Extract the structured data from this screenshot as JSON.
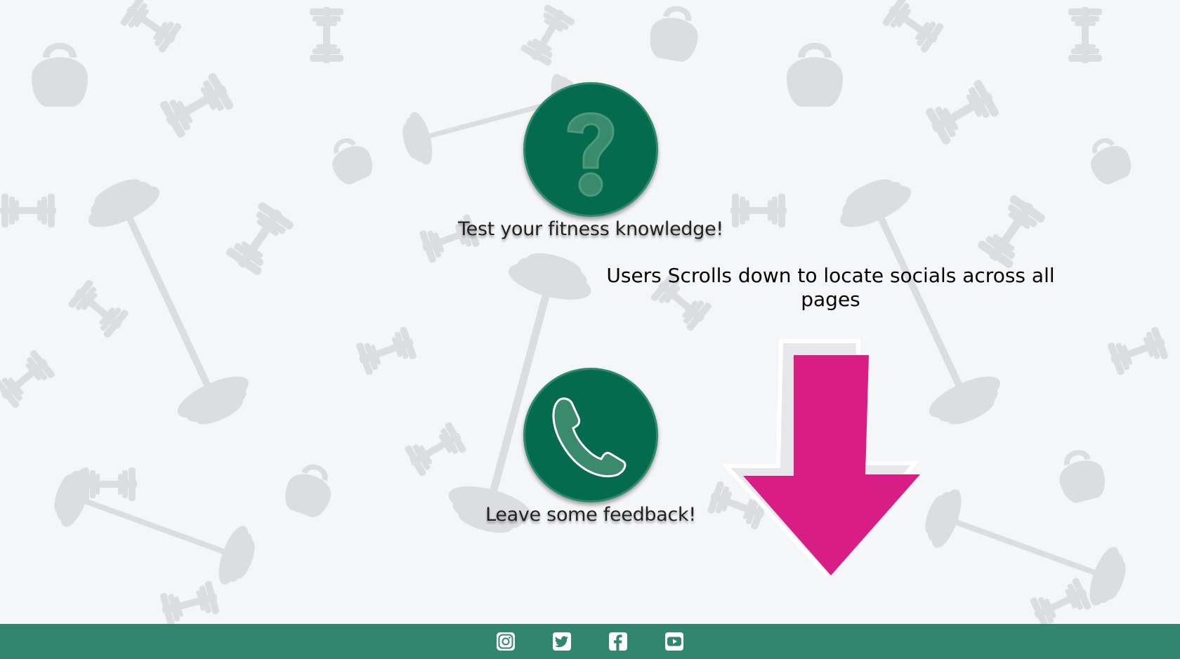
{
  "features": [
    {
      "label": "Test your fitness knowledge!",
      "icon": "question-mark-icon"
    },
    {
      "label": "Leave some feedback!",
      "icon": "phone-icon"
    }
  ],
  "annotation": {
    "text": "Users Scrolls down to locate socials across all pages"
  },
  "footer": {
    "socials": [
      "instagram-icon",
      "twitter-icon",
      "facebook-icon",
      "youtube-icon"
    ]
  },
  "colors": {
    "background": "#f5f6f8",
    "pattern": "#dcdde0",
    "accent_dark": "#046b4f",
    "accent_light": "#318670",
    "arrow": "#d81e84"
  }
}
